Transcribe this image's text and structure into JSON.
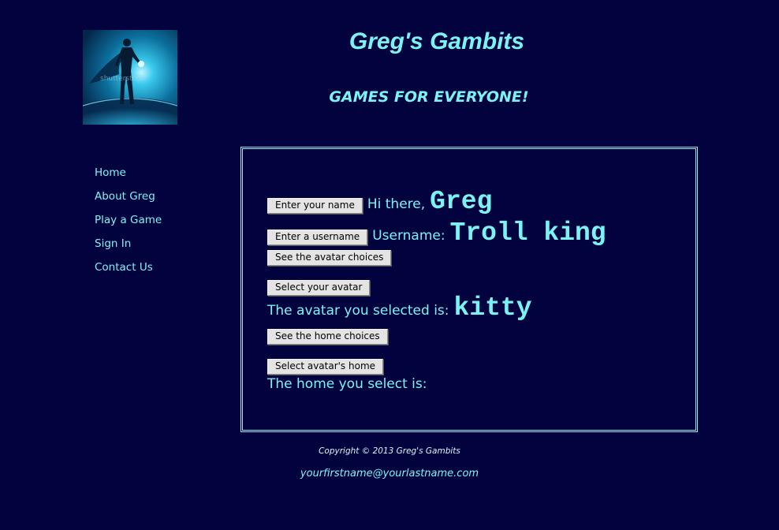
{
  "header": {
    "title": "Greg's Gambits",
    "tagline": "GAMES FOR EVERYONE!",
    "logo_watermark": "shutterstock"
  },
  "nav": {
    "items": [
      {
        "label": "Home"
      },
      {
        "label": "About Greg"
      },
      {
        "label": "Play a Game"
      },
      {
        "label": "Sign In"
      },
      {
        "label": "Contact Us"
      }
    ]
  },
  "main": {
    "name_button": "Enter your name",
    "greeting_label": "Hi there,",
    "greeting_value": "Greg",
    "username_button": "Enter a username",
    "username_label": "Username:",
    "username_value": "Troll king",
    "avatar_choices_button": "See the avatar choices",
    "select_avatar_button": "Select your avatar",
    "avatar_label": "The avatar you selected is:",
    "avatar_value": "kitty",
    "home_choices_button": "See the home choices",
    "select_home_button": "Select avatar's home",
    "home_label": "The home you select is:",
    "home_value": ""
  },
  "footer": {
    "copyright": "Copyright © 2013 Greg's Gambits",
    "email": "yourfirstname@yourlastname.com"
  },
  "colors": {
    "background": "#02023f",
    "accent": "#7cf3f3",
    "border": "#9eeaea"
  }
}
